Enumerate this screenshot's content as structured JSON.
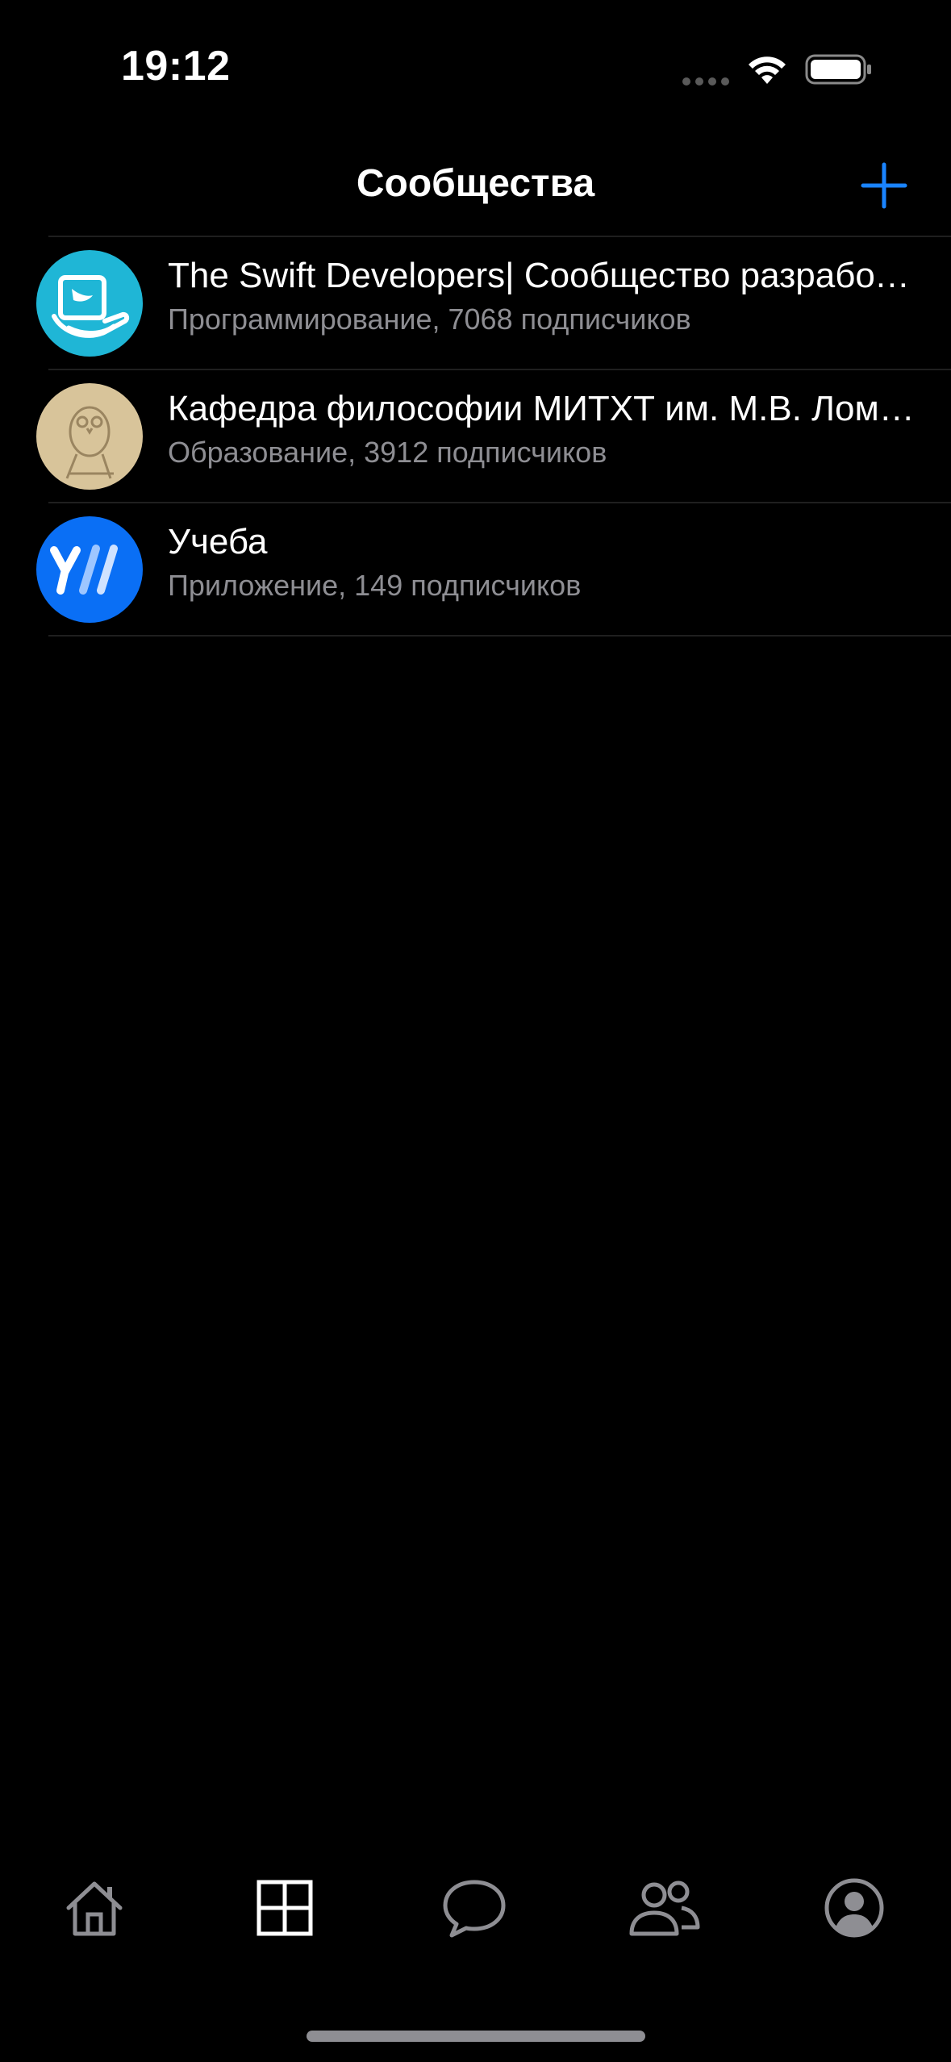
{
  "status_bar": {
    "time": "19:12"
  },
  "nav": {
    "title": "Сообщества",
    "add_icon": "plus-icon"
  },
  "colors": {
    "background": "#000000",
    "accent": "#1a84ff",
    "secondary_text": "#8e8e93",
    "tab_inactive": "#8e8e93",
    "tab_active": "#ffffff"
  },
  "communities": [
    {
      "title": "The Swift Developers| Сообщество разработчиков",
      "subtitle": "Программирование, 7068 подписчиков",
      "avatar_icon": "swift-community-avatar"
    },
    {
      "title": "Кафедра философии МИТХТ им. М.В. Ломоносова",
      "subtitle": "Образование, 3912 подписчиков",
      "avatar_icon": "owl-avatar"
    },
    {
      "title": "Учеба",
      "subtitle": "Приложение, 149 подписчиков",
      "avatar_icon": "ucheba-logo-avatar"
    }
  ],
  "tab_bar": {
    "items": [
      {
        "icon": "home-icon",
        "active": false
      },
      {
        "icon": "grid-icon",
        "active": true
      },
      {
        "icon": "chat-bubble-icon",
        "active": false
      },
      {
        "icon": "people-icon",
        "active": false
      },
      {
        "icon": "profile-icon",
        "active": false
      }
    ]
  }
}
